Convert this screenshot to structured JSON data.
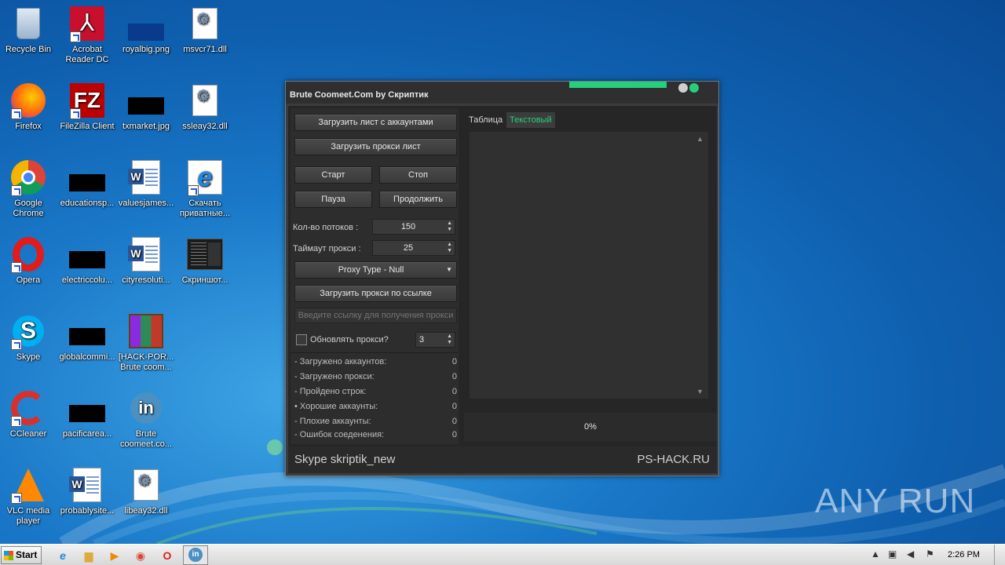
{
  "desktop": {
    "icons": [
      {
        "label": "Recycle Bin"
      },
      {
        "label": "Acrobat Reader DC"
      },
      {
        "label": "royalbig.png"
      },
      {
        "label": "msvcr71.dll"
      },
      {
        "label": "Firefox"
      },
      {
        "label": "FileZilla Client"
      },
      {
        "label": "txmarket.jpg"
      },
      {
        "label": "ssleay32.dll"
      },
      {
        "label": "Google Chrome"
      },
      {
        "label": "educationsp..."
      },
      {
        "label": "valuesjames..."
      },
      {
        "label": "Скачать приватные..."
      },
      {
        "label": "Opera"
      },
      {
        "label": "electriccolu..."
      },
      {
        "label": "cityresoluti..."
      },
      {
        "label": "Скриншот..."
      },
      {
        "label": "Skype"
      },
      {
        "label": "globalcommi..."
      },
      {
        "label": "[HACK-POR... Brute coom..."
      },
      {
        "label": "CCleaner"
      },
      {
        "label": "pacificarea..."
      },
      {
        "label": "Brute coomeet.co..."
      },
      {
        "label": "VLC media player"
      },
      {
        "label": "probablysite..."
      },
      {
        "label": "libeay32.dll"
      }
    ]
  },
  "app": {
    "title": "Brute Coomeet.Com by Скриптик",
    "buttons": {
      "load_accounts": "Загрузить лист с аккаунтами",
      "load_proxy": "Загрузить прокси лист",
      "start": "Старт",
      "stop": "Стоп",
      "pause": "Пауза",
      "continue": "Продолжить",
      "load_proxy_url": "Загрузить прокси по ссылке"
    },
    "threads": {
      "label": "Кол-во потоков :",
      "value": "150"
    },
    "proxy_timeout": {
      "label": "Таймаут прокси :",
      "value": "25"
    },
    "proxy_type": {
      "value": "Proxy Type - Null"
    },
    "proxy_url_input": {
      "placeholder": "Введите ссылку для получения прокси"
    },
    "update_proxy": {
      "label": "Обновлять прокси?",
      "value": "3",
      "checked": false
    },
    "stats": [
      {
        "label": "- Загружено аккаунтов:",
        "value": "0"
      },
      {
        "label": "- Загружено прокси:",
        "value": "0"
      },
      {
        "label": "- Пройдено строк:",
        "value": "0"
      },
      {
        "label": "• Хорошие аккаунты:",
        "value": "0"
      },
      {
        "label": "- Плохие аккаунты:",
        "value": "0"
      },
      {
        "label": "- Ошибок соеденения:",
        "value": "0"
      }
    ],
    "tabs": [
      {
        "label": "Таблица",
        "active": false
      },
      {
        "label": "Текстовый",
        "active": true
      }
    ],
    "progress": "0%",
    "footer_left": "Skype skriptik_new",
    "footer_right": "PS-HACK.RU",
    "colors": {
      "accent": "#25d07c",
      "bg": "#262626",
      "button": "#404040"
    }
  },
  "taskbar": {
    "start_label": "Start",
    "clock": "2:26 PM"
  },
  "watermark": "ANY RUN"
}
